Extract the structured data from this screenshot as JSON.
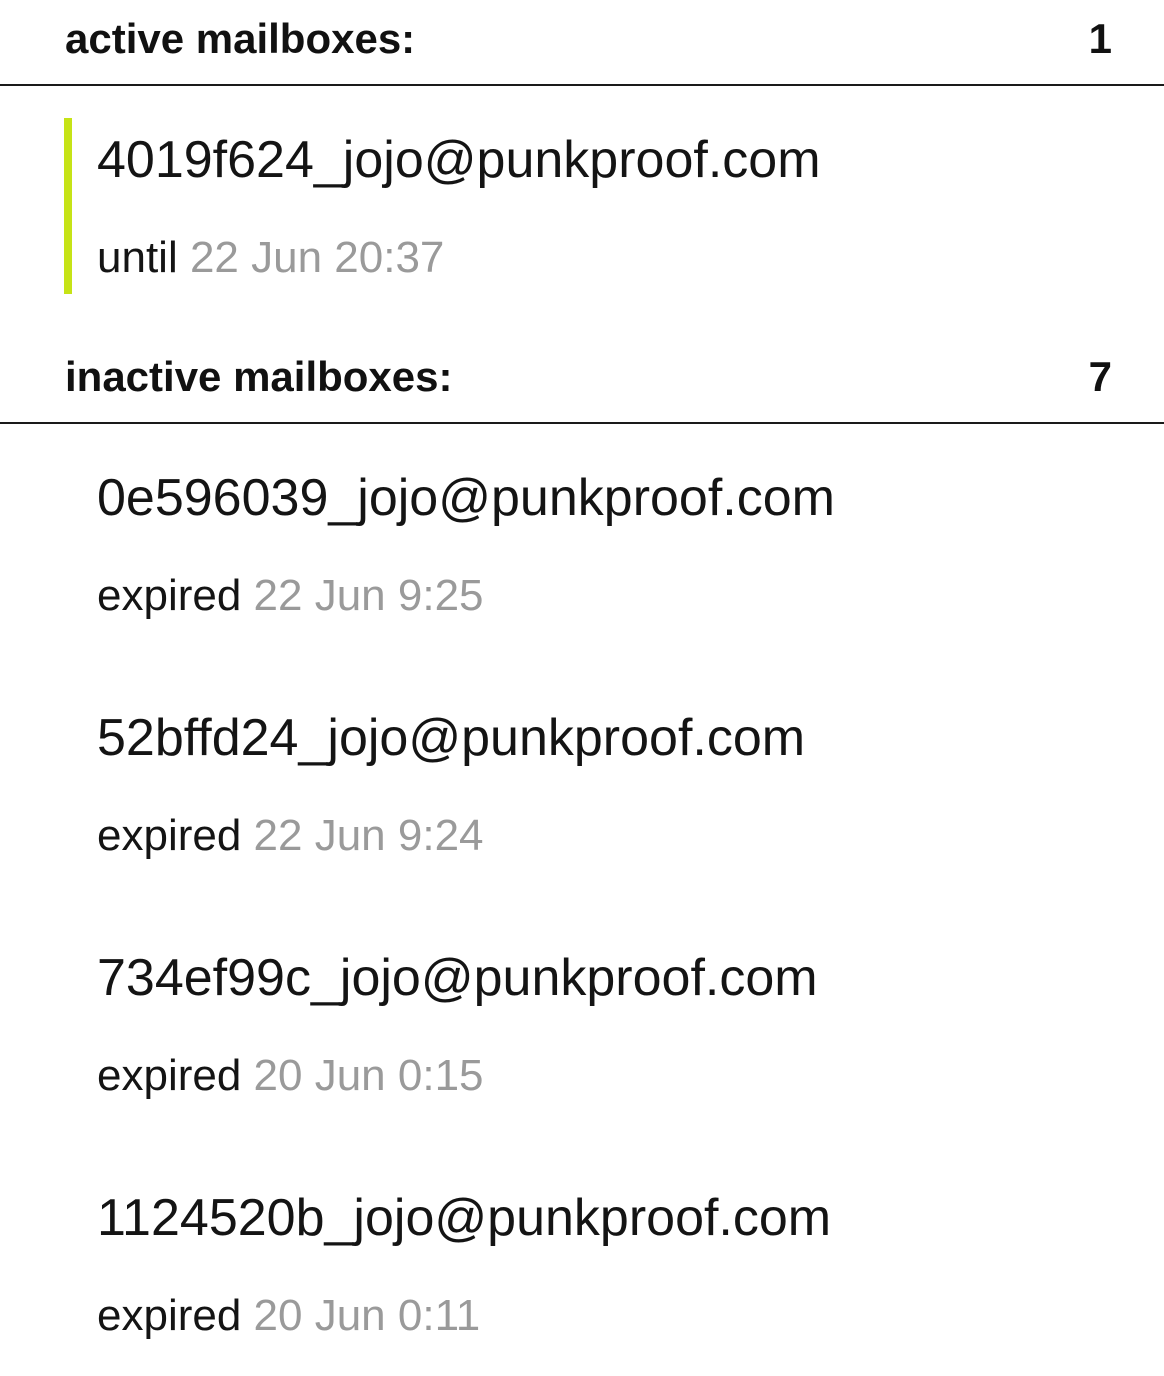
{
  "active_section": {
    "title": "active mailboxes:",
    "count": "1",
    "accent_color": "#c6e316",
    "items": [
      {
        "address": "4019f624_jojo@punkproof.com",
        "status_word": "until",
        "time": "22 Jun 20:37"
      }
    ]
  },
  "inactive_section": {
    "title": "inactive mailboxes:",
    "count": "7",
    "items": [
      {
        "address": "0e596039_jojo@punkproof.com",
        "status_word": "expired",
        "time": "22 Jun 9:25"
      },
      {
        "address": "52bffd24_jojo@punkproof.com",
        "status_word": "expired",
        "time": "22 Jun 9:24"
      },
      {
        "address": "734ef99c_jojo@punkproof.com",
        "status_word": "expired",
        "time": "20 Jun 0:15"
      },
      {
        "address": "1124520b_jojo@punkproof.com",
        "status_word": "expired",
        "time": "20 Jun 0:11"
      }
    ]
  }
}
